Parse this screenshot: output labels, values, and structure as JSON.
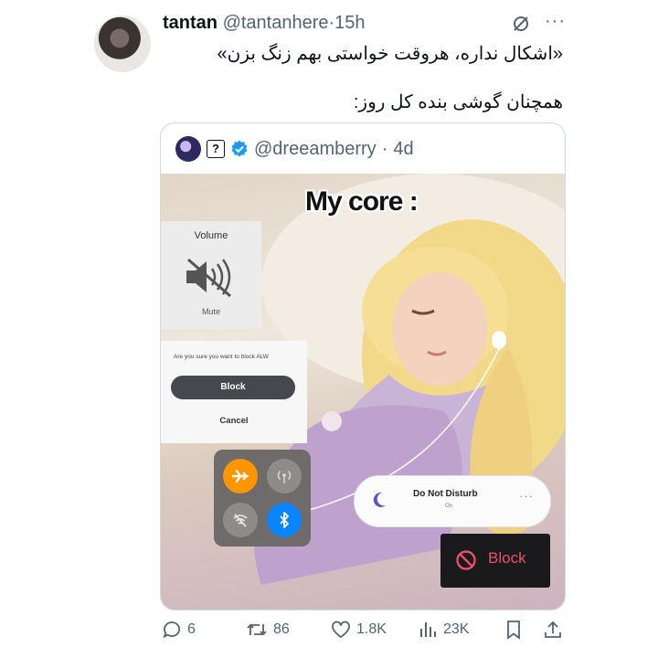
{
  "tweet": {
    "author_name": "tantan",
    "handle": "@tantanhere",
    "separator": "·",
    "time": "15h",
    "line1": "«اشکال نداره، هروقت خواستی بهم زنگ بزن»",
    "line2": "همچنان گوشی بنده کل روز:"
  },
  "quoted": {
    "badge": "?",
    "handle": "@dreeamberry",
    "separator": "·",
    "time": "4d",
    "meme_title": "My core :",
    "volume": {
      "title": "Volume",
      "state": "Mute"
    },
    "block_dialog": {
      "question": "Are you sure you want to block ALW",
      "confirm": "Block",
      "cancel": "Cancel"
    },
    "control_center": {
      "airplane": "on",
      "cellular": "off",
      "wifi": "off",
      "bluetooth": "on"
    },
    "dnd": {
      "title": "Do Not Disturb",
      "state": "On"
    },
    "blocked_button": "Block"
  },
  "actions": {
    "replies": "6",
    "reposts": "86",
    "likes": "1.8K",
    "views": "23K"
  },
  "colors": {
    "text": "#0f1419",
    "muted": "#536471",
    "verified": "#1d9bf0",
    "airplane_orange": "#ff9500",
    "bluetooth_blue": "#0a84ff",
    "block_red": "#e8506a"
  },
  "icons": [
    "grok-icon",
    "more-icon",
    "verified-icon",
    "mute-speaker-icon",
    "airplane-icon",
    "cellular-icon",
    "wifi-off-icon",
    "bluetooth-icon",
    "moon-icon",
    "block-icon",
    "reply-icon",
    "repost-icon",
    "like-icon",
    "views-icon",
    "bookmark-icon",
    "share-icon"
  ]
}
